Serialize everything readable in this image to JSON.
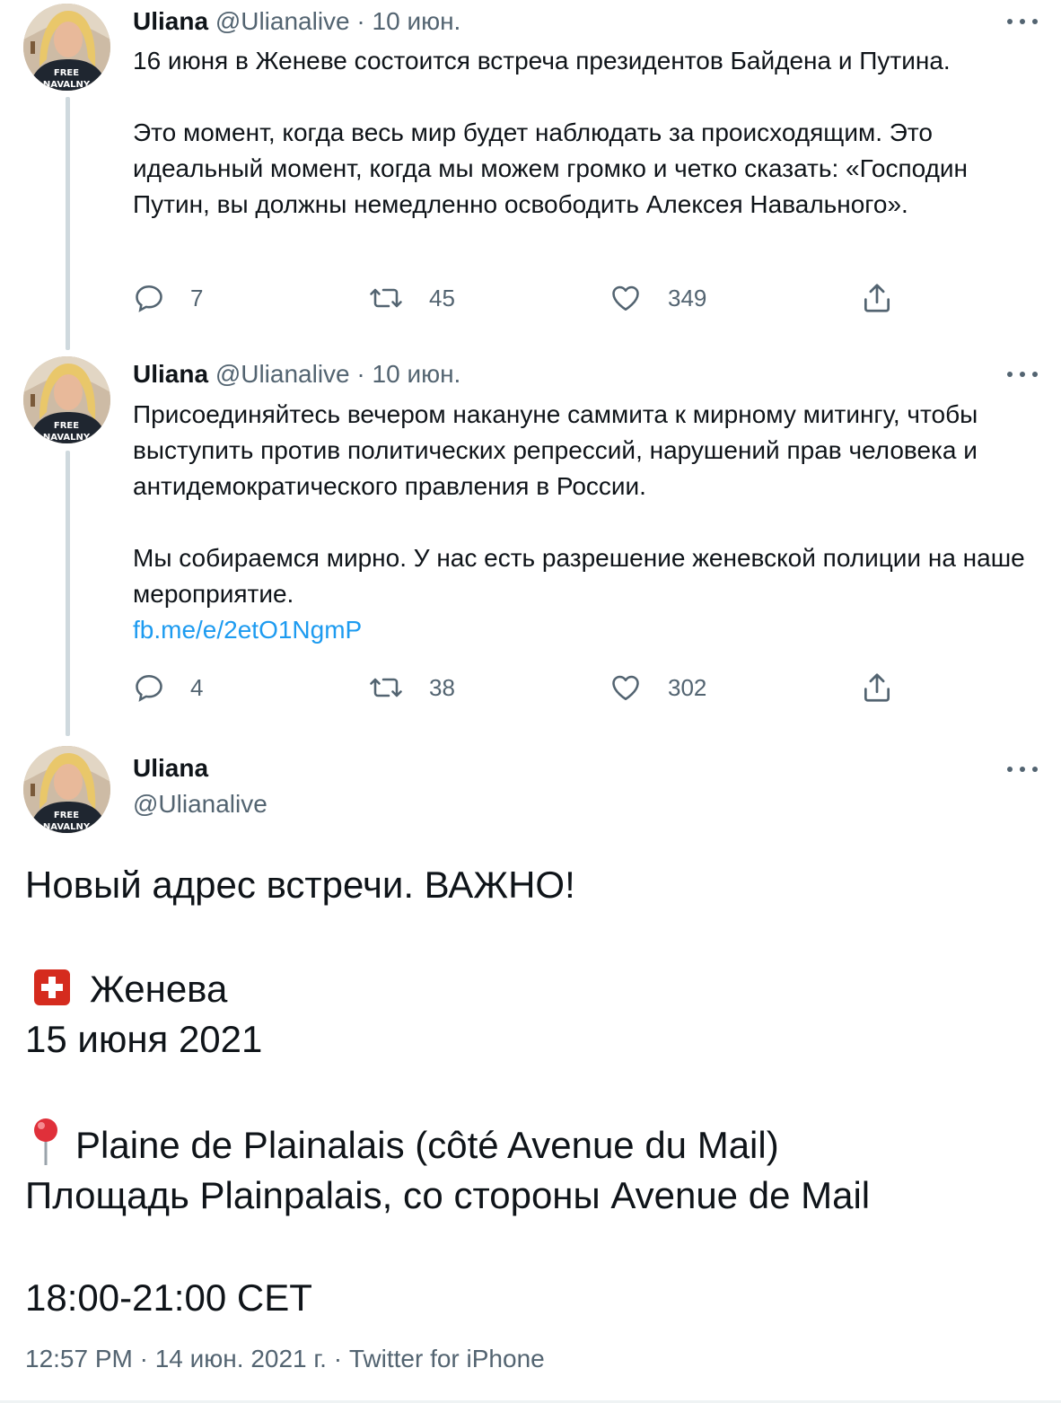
{
  "tweets": [
    {
      "name": "Uliana",
      "handle": "@Ulianalive",
      "sep": "·",
      "date": "10 июн.",
      "paragraphs": [
        "16 июня в Женеве состоится встреча президентов Байдена и Путина.",
        "Это момент, когда весь мир будет наблюдать за происходящим. Это идеальный момент, когда мы можем громко и четко сказать: «Господин Путин, вы должны немедленно освободить Алексея Навального»."
      ],
      "replies": "7",
      "retweets": "45",
      "likes": "349"
    },
    {
      "name": "Uliana",
      "handle": "@Ulianalive",
      "sep": "·",
      "date": "10 июн.",
      "paragraphs": [
        "Присоединяйтесь вечером накануне саммита к мирному митингу, чтобы выступить против политических репрессий, нарушений прав человека и антидемократического правления в России.",
        "Мы собираемся мирно. У нас есть разрешение женевской полиции на наше мероприятие."
      ],
      "link": "fb.me/e/2etO1NgmP",
      "replies": "4",
      "retweets": "38",
      "likes": "302"
    }
  ],
  "main_tweet": {
    "name": "Uliana",
    "handle": "@Ulianalive",
    "line1": "Новый адрес встречи. ВАЖНО!",
    "city": "Женева",
    "date": "15 июня 2021",
    "place_fr": "Plaine de Plainalais (côté Avenue du Mail)",
    "place_ru": "Площадь Plainpalais, со стороны Avenue de Mail",
    "time": "18:00-21:00 CET",
    "footer": "12:57 PM · 14 июн. 2021 г. · Twitter for iPhone"
  },
  "avatar_shirt_text": [
    "FREE",
    "NAVALNY"
  ],
  "colors": {
    "text": "#0f1419",
    "muted": "#536471",
    "link": "#1d9bf0",
    "thread_line": "#cfd9de",
    "flag_red": "#d52b1e"
  },
  "icons": [
    "reply-icon",
    "retweet-icon",
    "like-icon",
    "share-icon",
    "more-icon",
    "swiss-flag-icon",
    "pin-icon"
  ]
}
